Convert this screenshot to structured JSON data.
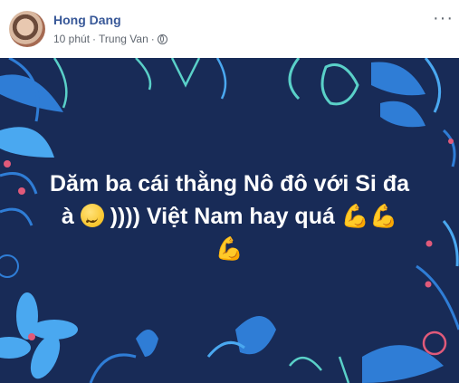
{
  "post": {
    "author": "Hong Dang",
    "time": "10 phút",
    "separator": "·",
    "location": "Trung Van",
    "more_label": "···",
    "text_line1": "Dăm ba cái thằng Nô đô với Si đa",
    "text_line2_a": "à",
    "text_line2_b": ")))) Việt Nam hay quá",
    "text_line2_emoji": "💪💪",
    "text_line3_emoji": "💪"
  },
  "colors": {
    "name": "#385898",
    "background": "#182b57",
    "leaf_blue": "#2f7dd6",
    "leaf_light": "#4aa8f0",
    "stroke_teal": "#5ad0c8",
    "accent_red": "#e05a7a"
  },
  "icons": {
    "globe": "globe-icon",
    "more": "more-options-icon",
    "smile": "smiling-face-icon",
    "muscle": "flexed-biceps-icon"
  }
}
